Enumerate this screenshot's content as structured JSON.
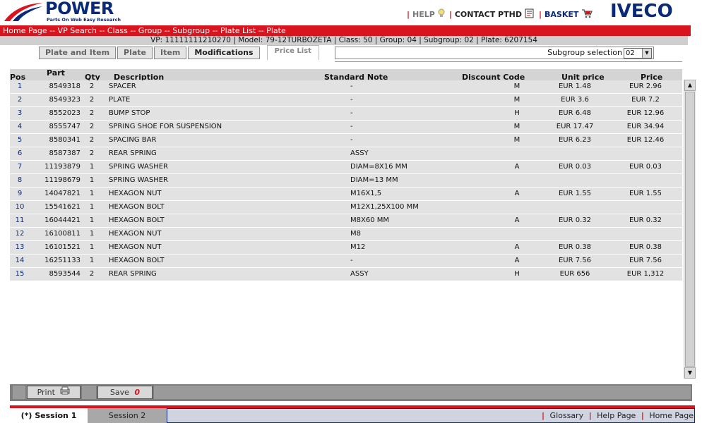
{
  "header": {
    "brand": "POWER",
    "tagline": "Parts On Web Easy Research",
    "iveco": "IVECO",
    "nav": {
      "help": "HELP",
      "contact": "CONTACT PTHD",
      "basket": "BASKET"
    }
  },
  "breadcrumb": "Home Page -- VP Search -- Class -- Group -- Subgroup -- Plate List -- Plate",
  "infobar": "VP: 11111111210270 | Model: 79-12TURBOZETA | Class: 50 | Group: 04 | Subgroup: 02 | Plate: 6207154",
  "tabs": {
    "plate_and_item": "Plate and Item",
    "plate": "Plate",
    "item": "Item",
    "modifications": "Modifications",
    "price_list": "Price List"
  },
  "subgroup": {
    "label": "Subgroup selection",
    "value": "02"
  },
  "columns": {
    "pos": "Pos",
    "part": "Part",
    "qty": "Qty",
    "description": "Description",
    "note": "Standard Note",
    "discount": "Discount Code",
    "unit_price": "Unit price",
    "price": "Price"
  },
  "rows": [
    {
      "pos": "1",
      "part": "8549318",
      "qty": "2",
      "desc": "SPACER",
      "note": "-",
      "disc": "M",
      "unit": "EUR 1.48",
      "price": "EUR 2.96"
    },
    {
      "pos": "2",
      "part": "8549323",
      "qty": "2",
      "desc": "PLATE",
      "note": "-",
      "disc": "M",
      "unit": "EUR 3.6",
      "price": "EUR 7.2"
    },
    {
      "pos": "3",
      "part": "8552023",
      "qty": "2",
      "desc": "BUMP STOP",
      "note": "-",
      "disc": "H",
      "unit": "EUR 6.48",
      "price": "EUR 12.96"
    },
    {
      "pos": "4",
      "part": "8555747",
      "qty": "2",
      "desc": "SPRING SHOE FOR SUSPENSION",
      "note": "-",
      "disc": "M",
      "unit": "EUR 17.47",
      "price": "EUR 34.94"
    },
    {
      "pos": "5",
      "part": "8580341",
      "qty": "2",
      "desc": "SPACING BAR",
      "note": "-",
      "disc": "M",
      "unit": "EUR 6.23",
      "price": "EUR 12.46"
    },
    {
      "pos": "6",
      "part": "8587387",
      "qty": "2",
      "desc": "REAR SPRING",
      "note": "ASSY",
      "disc": "",
      "unit": "",
      "price": ""
    },
    {
      "pos": "7",
      "part": "11193879",
      "qty": "1",
      "desc": "SPRING WASHER",
      "note": "DIAM=8X16 MM",
      "disc": "A",
      "unit": "EUR 0.03",
      "price": "EUR 0.03"
    },
    {
      "pos": "8",
      "part": "11198679",
      "qty": "1",
      "desc": "SPRING WASHER",
      "note": "DIAM=13 MM",
      "disc": "",
      "unit": "",
      "price": ""
    },
    {
      "pos": "9",
      "part": "14047821",
      "qty": "1",
      "desc": "HEXAGON NUT",
      "note": "M16X1,5",
      "disc": "A",
      "unit": "EUR 1.55",
      "price": "EUR 1.55"
    },
    {
      "pos": "10",
      "part": "15541621",
      "qty": "1",
      "desc": "HEXAGON BOLT",
      "note": "M12X1,25X100 MM",
      "disc": "",
      "unit": "",
      "price": ""
    },
    {
      "pos": "11",
      "part": "16044421",
      "qty": "1",
      "desc": "HEXAGON BOLT",
      "note": "M8X60 MM",
      "disc": "A",
      "unit": "EUR 0.32",
      "price": "EUR 0.32"
    },
    {
      "pos": "12",
      "part": "16100811",
      "qty": "1",
      "desc": "HEXAGON NUT",
      "note": "M8",
      "disc": "",
      "unit": "",
      "price": ""
    },
    {
      "pos": "13",
      "part": "16101521",
      "qty": "1",
      "desc": "HEXAGON NUT",
      "note": "M12",
      "disc": "A",
      "unit": "EUR 0.38",
      "price": "EUR 0.38"
    },
    {
      "pos": "14",
      "part": "16251133",
      "qty": "1",
      "desc": "HEXAGON BOLT",
      "note": "-",
      "disc": "A",
      "unit": "EUR 7.56",
      "price": "EUR 7.56"
    },
    {
      "pos": "15",
      "part": "8593544",
      "qty": "2",
      "desc": "REAR SPRING",
      "note": "ASSY",
      "disc": "H",
      "unit": "EUR 656",
      "price": "EUR 1,312"
    }
  ],
  "toolbar": {
    "print": "Print",
    "save": "Save",
    "save_count": "0"
  },
  "sessions": {
    "s1": "(*) Session 1",
    "s2": "Session 2"
  },
  "footer": {
    "glossary": "Glossary",
    "help_page": "Help Page",
    "home_page": "Home Page"
  },
  "colors": {
    "red": "#d8151f",
    "navy": "#0a2a78",
    "row_bg": "#e2e2e2"
  }
}
